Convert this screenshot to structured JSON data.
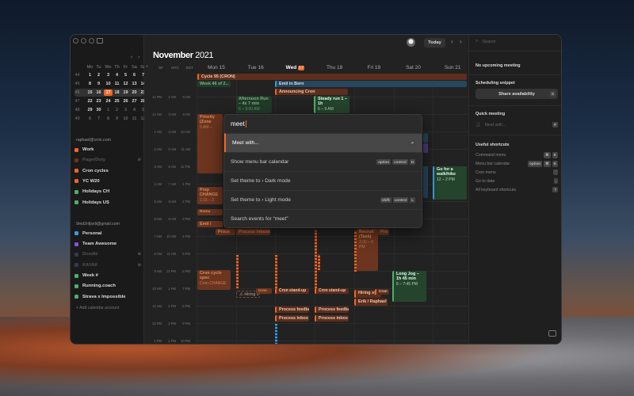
{
  "mini_calendar": {
    "weekday_headers": [
      "Mo",
      "Tu",
      "We",
      "Th",
      "Fr",
      "Sa",
      "Su"
    ],
    "weeks": [
      {
        "num": "44",
        "days": [
          "1",
          "2",
          "3",
          "4",
          "5",
          "6",
          "7"
        ]
      },
      {
        "num": "45",
        "days": [
          "8",
          "9",
          "10",
          "11",
          "12",
          "13",
          "14"
        ]
      },
      {
        "num": "46",
        "days": [
          "15",
          "16",
          "17",
          "18",
          "19",
          "20",
          "21"
        ]
      },
      {
        "num": "47",
        "days": [
          "22",
          "23",
          "24",
          "25",
          "26",
          "27",
          "28"
        ]
      },
      {
        "num": "48",
        "days": [
          "29",
          "30",
          "1",
          "2",
          "3",
          "4",
          "5"
        ]
      },
      {
        "num": "49",
        "days": [
          "6",
          "7",
          "8",
          "9",
          "10",
          "11",
          "12"
        ]
      }
    ],
    "today": "17"
  },
  "accounts": [
    {
      "email": "raphael@cron.com",
      "calendars": [
        {
          "name": "Work",
          "color": "#f26522",
          "on": true
        },
        {
          "name": "PagerDuty",
          "color": "#6b3520",
          "on": false
        },
        {
          "name": "Cron cycles",
          "color": "#f26522",
          "on": true
        },
        {
          "name": "YC W20",
          "color": "#f26522",
          "on": true
        },
        {
          "name": "Holidays CH",
          "color": "#4caf6a",
          "on": true
        },
        {
          "name": "Holidays US",
          "color": "#4caf6a",
          "on": true
        }
      ]
    },
    {
      "email": "9md2nfjsxli@gmail.com",
      "calendars": [
        {
          "name": "Personal",
          "color": "#3a9be0",
          "on": true
        },
        {
          "name": "Team Awesome",
          "color": "#8a4ee0",
          "on": true
        },
        {
          "name": "Doodle",
          "color": "#333a55",
          "on": false
        },
        {
          "name": "KAYAK",
          "color": "#333a55",
          "on": false
        },
        {
          "name": "Week #",
          "color": "#4caf6a",
          "on": true
        },
        {
          "name": "Running.coach",
          "color": "#4caf6a",
          "on": true
        },
        {
          "name": "Strava x Impossible",
          "color": "#4caf6a",
          "on": true
        }
      ]
    }
  ],
  "add_account": "+  Add calendar account",
  "header": {
    "month": "November",
    "year": "2021",
    "today_button": "Today",
    "prev": "‹",
    "next": "›"
  },
  "timezones": [
    "SF",
    "NYC",
    "SGT"
  ],
  "days": [
    {
      "name": "Mon",
      "num": "15"
    },
    {
      "name": "Tue",
      "num": "16"
    },
    {
      "name": "Wed",
      "num": "17",
      "today": true
    },
    {
      "name": "Thu",
      "num": "18"
    },
    {
      "name": "Fri",
      "num": "19"
    },
    {
      "name": "Sat",
      "num": "20"
    },
    {
      "name": "Sun",
      "num": "21"
    }
  ],
  "hours": [
    [
      "11 PM",
      "2 AM",
      "6 AM"
    ],
    [
      "12 AM",
      "3 AM",
      "9 AM"
    ],
    [
      "1 AM",
      "4 AM",
      "10 AM"
    ],
    [
      "2 AM",
      "5 AM",
      "11 AM"
    ],
    [
      "3 AM",
      "6 AM",
      "12 PM"
    ],
    [
      "4 AM",
      "7 AM",
      "1 PM"
    ],
    [
      "5 AM",
      "8 AM",
      "2 PM"
    ],
    [
      "6 AM",
      "9 AM",
      "3 PM"
    ],
    [
      "7 AM",
      "10 AM",
      "4 PM"
    ],
    [
      "8 AM",
      "11 AM",
      "5 PM"
    ],
    [
      "9 AM",
      "12 PM",
      "6 PM"
    ],
    [
      "10 AM",
      "1 PM",
      "7 PM"
    ],
    [
      "11 AM",
      "2 PM",
      "8 PM"
    ],
    [
      "12 PM",
      "3 PM",
      "9 PM"
    ],
    [
      "1 PM",
      "4 PM",
      "10 PM"
    ]
  ],
  "events": {
    "cycle": "Cycle 95 (CRON)",
    "week46": "Week 46 of 2...",
    "emil_bern": "Emil in Bern",
    "announcing": "Announcing Cron",
    "afternoon_run": "Afternoon Run – 4x 7 min",
    "afternoon_run_time": "6 – 9:00 AM",
    "steady_run": "Steady run 1 – 1h",
    "steady_run_time": "6 – 9 AM",
    "priority": "Priority (Zone",
    "priority_time": "9 AM –",
    "prep": "Prep CHANGE",
    "prep_time": "1:15 – 2",
    "roma": "Roma",
    "emil_mon": "Emil /",
    "proce_mon": "Proce",
    "process_inbox_tue": "Process inboxe",
    "recruit": "Recruit (Task)",
    "recruit_time": "3:30 – 6 PM",
    "pro_fri": "Pro",
    "walk": "Go for a walk/hike",
    "walk_time": "12 – 2 PM",
    "long_jog": "Long Jog – 1h 45 min",
    "long_jog_time": "6 – 7:45 PM",
    "cron_cycle_spec": "Cron cycle spec",
    "cron_change": "Cron CHANGE",
    "hiring_tue": "⚠ Hiring s",
    "cron_tue": "Cron",
    "standup_wed": "Cron stand-up",
    "standup_thu": "Cron stand-up",
    "hiring_fri": "Hiring sy...",
    "cron_fri": "Cron",
    "erik": "Erik / Raphael",
    "feedback_wed": "Process feedba",
    "feedback_thu": "Process feedba",
    "inbox_wed": "Process inbox",
    "inbox_thu": "Process inbox"
  },
  "palette": {
    "query": "meet",
    "items": [
      {
        "label": "Meet with...",
        "keys": [
          "F"
        ]
      },
      {
        "label": "Show menu bar calendar",
        "keys": [
          "option",
          "control",
          "H"
        ]
      },
      {
        "label": "Set theme to  ›  Dark mode",
        "keys": []
      },
      {
        "label": "Set theme to  ›  Light mode",
        "keys": [
          "shift",
          "control",
          "L"
        ]
      },
      {
        "label": "Search events for “meet”",
        "keys": []
      }
    ]
  },
  "right_panel": {
    "search_placeholder": "Search",
    "no_meeting": "No upcoming meeting",
    "scheduling_title": "Scheduling snippet",
    "share_button": "Share availability",
    "share_key": "S",
    "quick_title": "Quick meeting",
    "meet_placeholder": "Meet with...",
    "meet_key": "F",
    "shortcuts_title": "Useful shortcuts",
    "shortcuts": [
      {
        "label": "Command menu",
        "keys": [
          "⌘",
          "K"
        ]
      },
      {
        "label": "Menu bar calendar",
        "keys": [
          "option",
          "⌘",
          "K"
        ]
      },
      {
        "label": "Cron menu",
        "keys": [
          "`"
        ]
      },
      {
        "label": "Go to date",
        "keys": [
          "."
        ]
      },
      {
        "label": "All keyboard shortcuts",
        "keys": [
          "?"
        ]
      }
    ]
  }
}
